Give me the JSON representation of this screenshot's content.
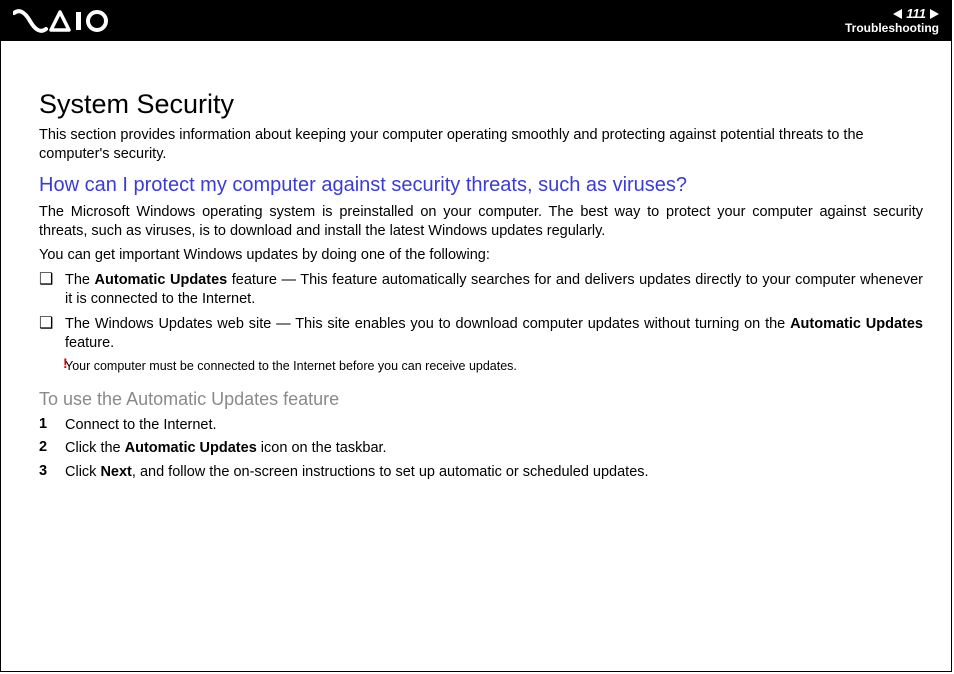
{
  "header": {
    "page_number": "111",
    "section": "Troubleshooting"
  },
  "title": "System Security",
  "intro": "This section provides information about keeping your computer operating smoothly and protecting against potential threats to the computer's security.",
  "question": "How can I protect my computer against security threats, such as viruses?",
  "para1": "The Microsoft Windows operating system is preinstalled on your computer. The best way to protect your computer against security threats, such as viruses, is to download and install the latest Windows updates regularly.",
  "para2": "You can get important Windows updates by doing one of the following:",
  "bullet1_pre": "The ",
  "bullet1_b": "Automatic Updates",
  "bullet1_post": " feature — This feature automatically searches for and delivers updates directly to your computer whenever it is connected to the Internet.",
  "bullet2_pre": "The Windows Updates web site — This site enables you to download computer updates without turning on the ",
  "bullet2_b": "Automatic Updates",
  "bullet2_post": " feature.",
  "note_mark": "!",
  "note": "Your computer must be connected to the Internet before you can receive updates.",
  "subheading": "To use the Automatic Updates feature",
  "step1": "Connect to the Internet.",
  "step2_pre": "Click the ",
  "step2_b": "Automatic Updates",
  "step2_post": " icon on the taskbar.",
  "step3_pre": "Click ",
  "step3_b": "Next",
  "step3_post": ", and follow the on-screen instructions to set up automatic or scheduled updates."
}
